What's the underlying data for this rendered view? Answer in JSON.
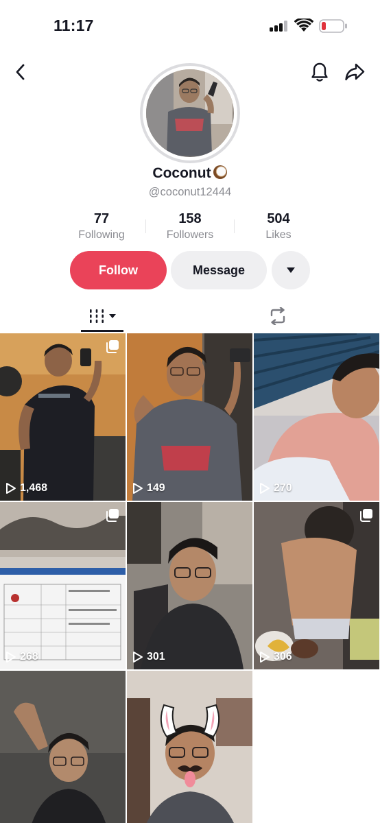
{
  "status_bar": {
    "time": "11:17"
  },
  "profile": {
    "display_name": "Coconut",
    "handle": "@coconut12444",
    "stats": [
      {
        "value": "77",
        "label": "Following"
      },
      {
        "value": "158",
        "label": "Followers"
      },
      {
        "value": "504",
        "label": "Likes"
      }
    ]
  },
  "actions": {
    "follow_label": "Follow",
    "message_label": "Message"
  },
  "icons": {
    "back": "chevron-left-icon",
    "notifications": "bell-icon",
    "share": "share-arrow-icon",
    "videos_tab": "video-grid-icon",
    "reposts_tab": "repost-icon",
    "more": "caret-down-icon",
    "play": "play-outline-icon",
    "multi": "carousel-icon"
  },
  "colors": {
    "follow_button": "#ea4359",
    "secondary_button": "#efeff1",
    "muted_text": "#8a8b91",
    "text": "#161823",
    "battery_low": "#e0323c"
  },
  "videos": [
    {
      "views": "1,468",
      "multi": true
    },
    {
      "views": "149",
      "multi": false
    },
    {
      "views": "270",
      "multi": false
    },
    {
      "views": "268",
      "multi": true
    },
    {
      "views": "301",
      "multi": false
    },
    {
      "views": "306",
      "multi": true
    },
    {
      "views": "",
      "multi": false
    },
    {
      "views": "",
      "multi": false
    }
  ]
}
